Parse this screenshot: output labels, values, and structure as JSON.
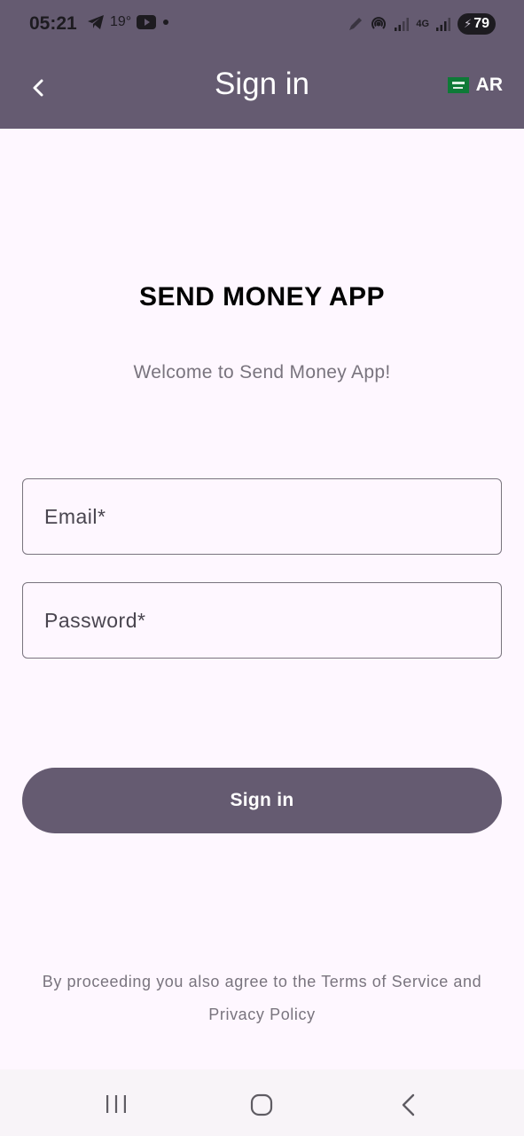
{
  "status_bar": {
    "time": "05:21",
    "temperature": "19°",
    "battery": "79",
    "network": "4G"
  },
  "app_bar": {
    "title": "Sign in",
    "language": "AR",
    "back_icon": "chevron-left-icon",
    "flag_icon": "saudi-flag-icon"
  },
  "main": {
    "brand_title": "SEND MONEY APP",
    "welcome_text": "Welcome to Send Money App!",
    "email_placeholder": "Email*",
    "password_placeholder": "Password*",
    "signin_button": "Sign in",
    "terms_text": "By proceeding you also agree to the Terms of Service and Privacy Policy"
  },
  "nav_bar": {
    "recents_icon": "recents-icon",
    "home_icon": "home-icon",
    "back_icon": "back-icon"
  },
  "colors": {
    "primary": "#655B71",
    "background": "#FEF7FF",
    "on_primary": "#FFFFFF",
    "secondary_text": "#79747E"
  }
}
